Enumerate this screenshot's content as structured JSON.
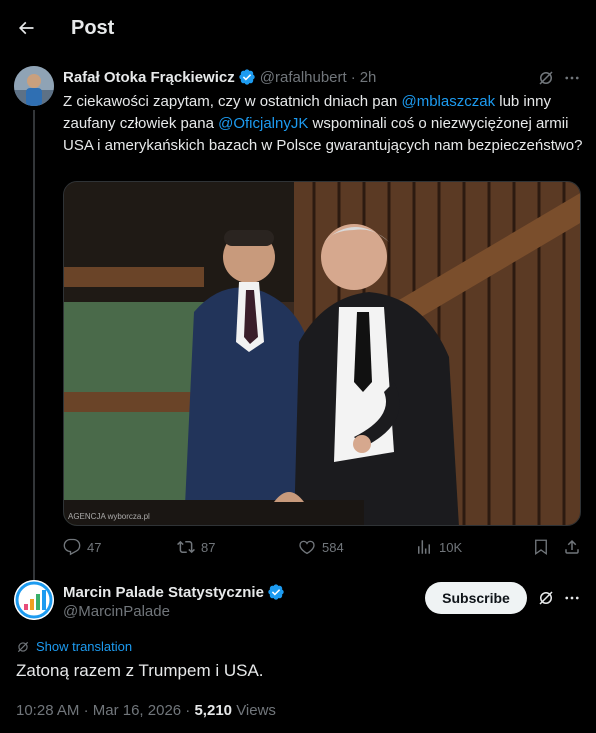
{
  "header": {
    "title": "Post"
  },
  "quoted_post": {
    "author_name": "Rafał Otoka Frąckiewicz",
    "author_handle": "@rafalhubert",
    "separator": "·",
    "time_ago": "2h",
    "text_parts": [
      {
        "t": "Z ciekawości zapytam, czy w ostatnich dniach pan ",
        "m": false
      },
      {
        "t": "@mblaszczak",
        "m": true
      },
      {
        "t": " lub inny zaufany człowiek pana ",
        "m": false
      },
      {
        "t": "@OficjalnyJK",
        "m": true
      },
      {
        "t": " wspominali coś o niezwyciężonej armii USA i  amerykańskich bazach w Polsce gwarantujących nam bezpieczeństwo?",
        "m": false
      }
    ],
    "image_watermark": "AGENCJA wyborcza.pl",
    "stats": {
      "replies": "47",
      "reposts": "87",
      "likes": "584",
      "views": "10K"
    }
  },
  "main_post": {
    "author_name": "Marcin Palade Statystycznie",
    "author_handle": "@MarcinPalade",
    "subscribe_label": "Subscribe",
    "show_translation": "Show translation",
    "text": "Zatoną razem z Trumpem i USA.",
    "time": "10:28 AM",
    "date": "Mar 16, 2026",
    "views_count": "5,210",
    "views_label": "Views",
    "separator": "·"
  },
  "colors": {
    "accent": "#1d9bf0",
    "background": "#000000",
    "muted": "#71767b"
  }
}
